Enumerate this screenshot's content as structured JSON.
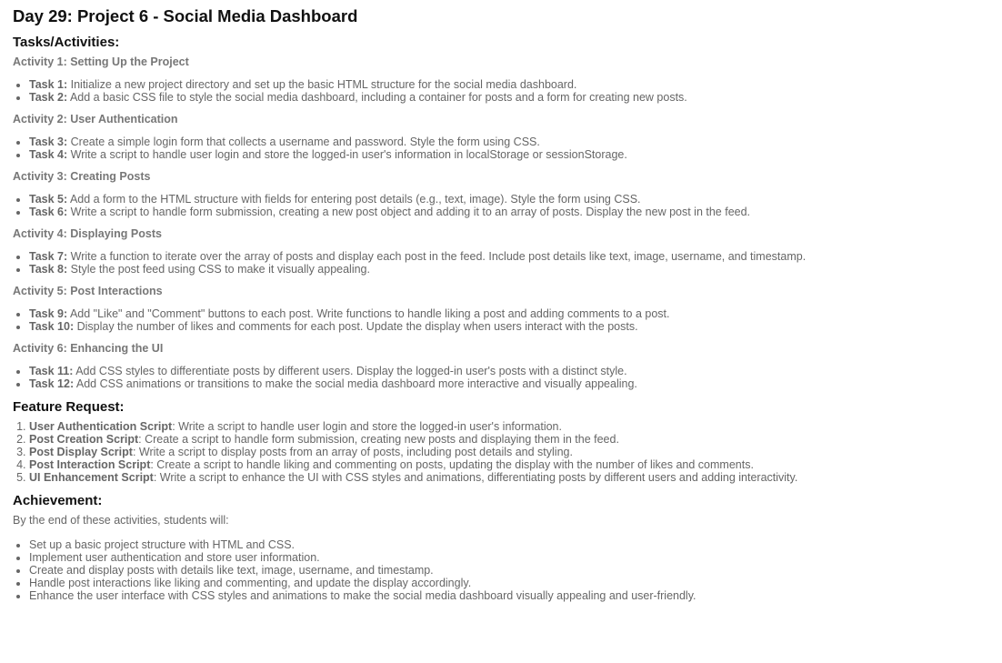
{
  "title": "Day 29: Project 6 - Social Media Dashboard",
  "tasks_heading": "Tasks/Activities:",
  "activities": [
    {
      "heading": "Activity 1: Setting Up the Project",
      "tasks": [
        {
          "label": "Task 1:",
          "text": " Initialize a new project directory and set up the basic HTML structure for the social media dashboard."
        },
        {
          "label": "Task 2:",
          "text": " Add a basic CSS file to style the social media dashboard, including a container for posts and a form for creating new posts."
        }
      ]
    },
    {
      "heading": "Activity 2: User Authentication",
      "tasks": [
        {
          "label": "Task 3:",
          "text": " Create a simple login form that collects a username and password. Style the form using CSS."
        },
        {
          "label": "Task 4:",
          "text": " Write a script to handle user login and store the logged-in user's information in localStorage or sessionStorage."
        }
      ]
    },
    {
      "heading": "Activity 3: Creating Posts",
      "tasks": [
        {
          "label": "Task 5:",
          "text": " Add a form to the HTML structure with fields for entering post details (e.g., text, image). Style the form using CSS."
        },
        {
          "label": "Task 6:",
          "text": " Write a script to handle form submission, creating a new post object and adding it to an array of posts. Display the new post in the feed."
        }
      ]
    },
    {
      "heading": "Activity 4: Displaying Posts",
      "tasks": [
        {
          "label": "Task 7:",
          "text": " Write a function to iterate over the array of posts and display each post in the feed. Include post details like text, image, username, and timestamp."
        },
        {
          "label": "Task 8:",
          "text": " Style the post feed using CSS to make it visually appealing."
        }
      ]
    },
    {
      "heading": "Activity 5: Post Interactions",
      "tasks": [
        {
          "label": "Task 9:",
          "text": " Add \"Like\" and \"Comment\" buttons to each post. Write functions to handle liking a post and adding comments to a post."
        },
        {
          "label": "Task 10:",
          "text": " Display the number of likes and comments for each post. Update the display when users interact with the posts."
        }
      ]
    },
    {
      "heading": "Activity 6: Enhancing the UI",
      "tasks": [
        {
          "label": "Task 11:",
          "text": " Add CSS styles to differentiate posts by different users. Display the logged-in user's posts with a distinct style."
        },
        {
          "label": "Task 12:",
          "text": " Add CSS animations or transitions to make the social media dashboard more interactive and visually appealing."
        }
      ]
    }
  ],
  "feature_heading": "Feature Request:",
  "features": [
    {
      "label": "User Authentication Script",
      "text": ": Write a script to handle user login and store the logged-in user's information."
    },
    {
      "label": "Post Creation Script",
      "text": ": Create a script to handle form submission, creating new posts and displaying them in the feed."
    },
    {
      "label": "Post Display Script",
      "text": ": Write a script to display posts from an array of posts, including post details and styling."
    },
    {
      "label": "Post Interaction Script",
      "text": ": Create a script to handle liking and commenting on posts, updating the display with the number of likes and comments."
    },
    {
      "label": "UI Enhancement Script",
      "text": ": Write a script to enhance the UI with CSS styles and animations, differentiating posts by different users and adding interactivity."
    }
  ],
  "achievement_heading": "Achievement:",
  "achievement_lead": "By the end of these activities, students will:",
  "achievements": [
    "Set up a basic project structure with HTML and CSS.",
    "Implement user authentication and store user information.",
    "Create and display posts with details like text, image, username, and timestamp.",
    "Handle post interactions like liking and commenting, and update the display accordingly.",
    "Enhance the user interface with CSS styles and animations to make the social media dashboard visually appealing and user-friendly."
  ]
}
